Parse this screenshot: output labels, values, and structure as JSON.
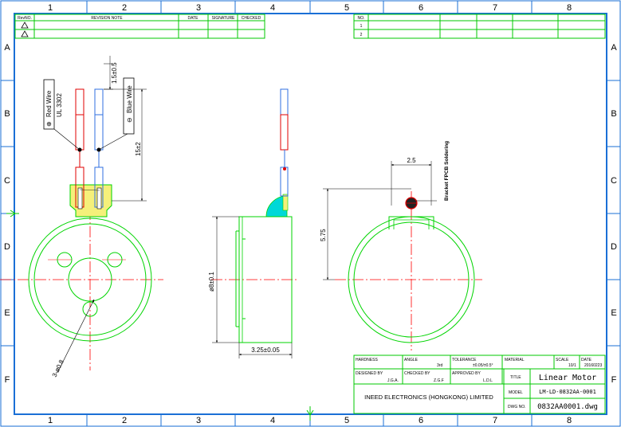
{
  "border": {
    "columns": [
      "1",
      "2",
      "3",
      "4",
      "5",
      "6",
      "7",
      "8"
    ],
    "rows": [
      "A",
      "B",
      "C",
      "D",
      "E",
      "F"
    ]
  },
  "revision_table": {
    "headers": [
      "RevNO.",
      "REVISION NOTE",
      "DATE",
      "SIGNATURE",
      "CHECKED"
    ]
  },
  "no_table": {
    "header": "NO.",
    "rows": [
      "1",
      "2"
    ]
  },
  "labels": {
    "red_wire": "Red Wire",
    "ul": "UL 3302",
    "blue_wire": "Blue Wire",
    "plus_symbol": "⊕",
    "minus_symbol": "⊖",
    "bracket_note": "Bracket FPCB Soldering"
  },
  "dimensions": {
    "wire_strip": "1.5±0.5",
    "wire_length": "15±2",
    "diameter": "ø8±0.1",
    "thickness": "3.25±0.05",
    "bracket_width": "2.5",
    "bracket_height": "5.75",
    "hole": "3-ø0.8"
  },
  "title_block": {
    "hardness_label": "HARDNESS",
    "angle_label": "ANGLE",
    "angle_value": "3rd",
    "tolerance_label": "TOLERANCE",
    "tolerance_value": "±0.05/±0.5°",
    "material_label": "MATERIAL",
    "scale_label": "SCALE",
    "scale_value": "10/1",
    "date_label": "DATE",
    "date_value": "20160223",
    "designed_label": "DESIGNED BY",
    "designed_value": "J.G.A.",
    "checked_label": "CHECKED BY",
    "checked_value": "Z.G.F",
    "approved_label": "APPROVED BY",
    "approved_value": "L.D.L",
    "title_label": "TITLE",
    "title_value": "Linear Motor",
    "company": "INEED ELECTRONICS (HONGKONG) LIMITED",
    "model_label": "MODEL",
    "model_value": "LM-LD-0832AA-0001",
    "dwg_label": "DWG NO.",
    "dwg_value": "0832AA0001.dwg"
  },
  "colors": {
    "frame": "#1a6fd6",
    "outline": "#00d400",
    "center": "#ff0000",
    "dimension": "#000000",
    "wire_red": "#e00000",
    "wire_blue": "#2f6fe0",
    "connector": "#f5f07a",
    "cyan": "#00d8d8"
  }
}
